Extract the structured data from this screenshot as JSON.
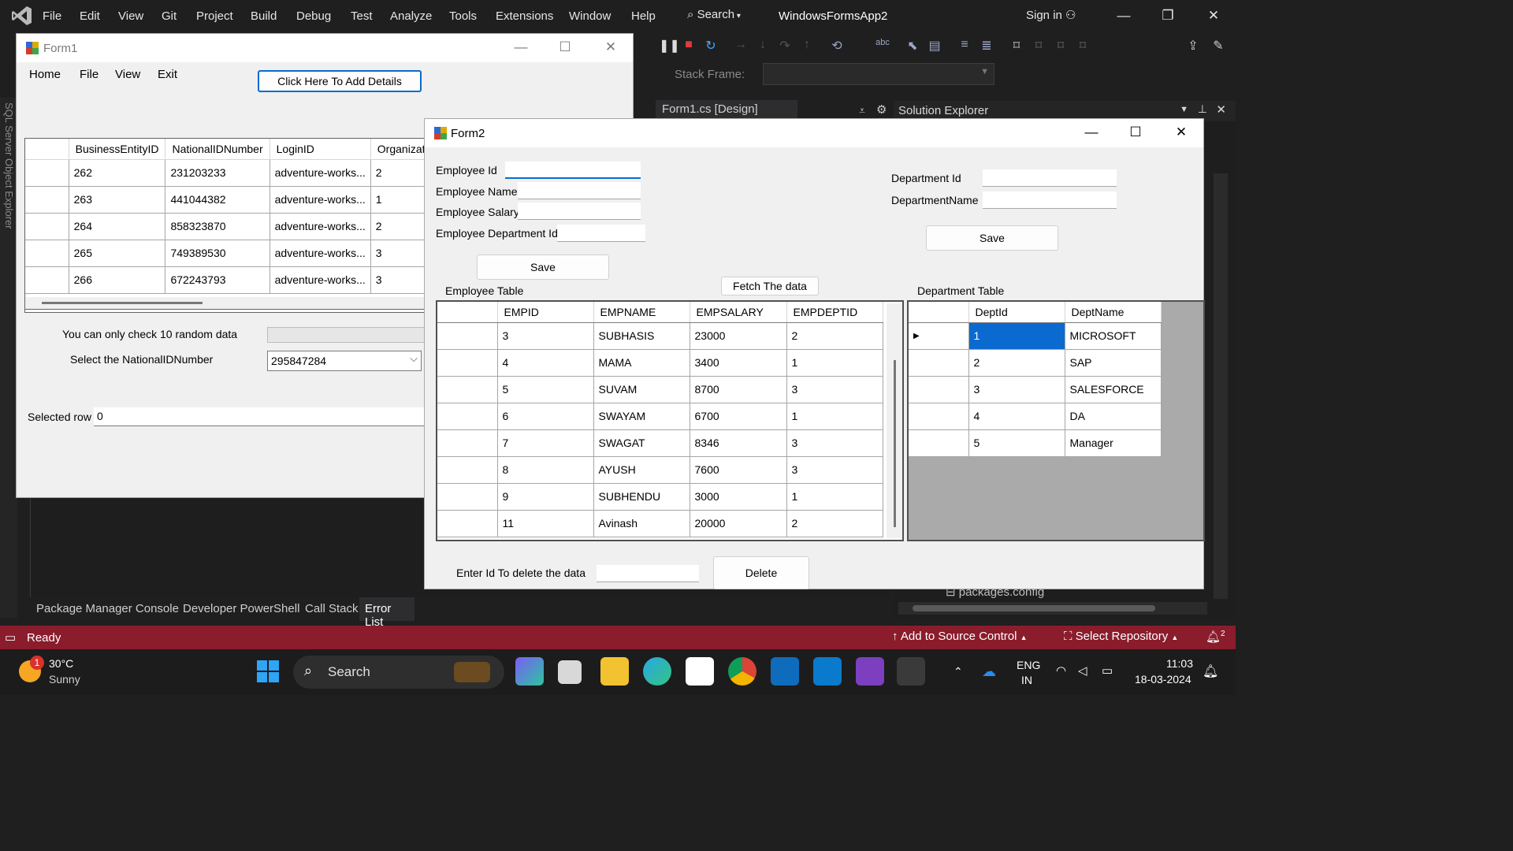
{
  "vs": {
    "menu": [
      "File",
      "Edit",
      "View",
      "Git",
      "Project",
      "Build",
      "Debug",
      "Test",
      "Analyze",
      "Tools",
      "Extensions",
      "Window",
      "Help"
    ],
    "search_label": "Search",
    "app_name": "WindowsFormsApp2",
    "sign_in": "Sign in",
    "stack_frame_label": "Stack Frame:",
    "design_tab": "Form1.cs [Design]",
    "solution_explorer_title": "Solution Explorer",
    "packages_config": "packages.config",
    "left_stripe_text": "SQL Server Object Explorer",
    "bottom_tabs": [
      "Package Manager Console",
      "Developer PowerShell",
      "Call Stack",
      "Error List"
    ]
  },
  "statusbar": {
    "ready": "Ready",
    "add_source": "Add to Source Control",
    "select_repo": "Select Repository",
    "notif_count": "2"
  },
  "taskbar": {
    "weather_badge": "1",
    "temp": "30°C",
    "condition": "Sunny",
    "search": "Search",
    "lang1": "ENG",
    "lang2": "IN",
    "time": "11:03",
    "date": "18-03-2024"
  },
  "form1": {
    "title": "Form1",
    "menu": [
      "Home",
      "File",
      "View",
      "Exit"
    ],
    "add_button": "Click Here To Add Details",
    "grid_headers": [
      "BusinessEntityID",
      "NationalIDNumber",
      "LoginID",
      "Organizat"
    ],
    "grid_rows": [
      [
        "262",
        "231203233",
        "adventure-works...",
        "2"
      ],
      [
        "263",
        "441044382",
        "adventure-works...",
        "1"
      ],
      [
        "264",
        "858323870",
        "adventure-works...",
        "2"
      ],
      [
        "265",
        "749389530",
        "adventure-works...",
        "3"
      ],
      [
        "266",
        "672243793",
        "adventure-works...",
        "3"
      ]
    ],
    "random_label": "You can only check 10 random data",
    "select_label": "Select the NationalIDNumber",
    "select_value": "295847284",
    "selected_row_label": "Selected row",
    "selected_row_value": "0"
  },
  "form2": {
    "title": "Form2",
    "emp_id_label": "Employee Id",
    "emp_name_label": "Employee Name",
    "emp_salary_label": "Employee Salary",
    "emp_dept_label": "Employee Department Id",
    "save_label": "Save",
    "dept_id_label": "Department Id",
    "dept_name_label": "DepartmentName",
    "dept_save_label": "Save",
    "fetch_label": "Fetch The data",
    "emp_table_label": "Employee Table",
    "dept_table_label": "Department Table",
    "emp_headers": [
      "EMPID",
      "EMPNAME",
      "EMPSALARY",
      "EMPDEPTID"
    ],
    "emp_rows": [
      [
        "3",
        "SUBHASIS",
        "23000",
        "2"
      ],
      [
        "4",
        "MAMA",
        "3400",
        "1"
      ],
      [
        "5",
        "SUVAM",
        "8700",
        "3"
      ],
      [
        "6",
        "SWAYAM",
        "6700",
        "1"
      ],
      [
        "7",
        "SWAGAT",
        "8346",
        "3"
      ],
      [
        "8",
        "AYUSH",
        "7600",
        "3"
      ],
      [
        "9",
        "SUBHENDU",
        "3000",
        "1"
      ],
      [
        "11",
        "Avinash",
        "20000",
        "2"
      ]
    ],
    "dept_headers": [
      "DeptId",
      "DeptName"
    ],
    "dept_rows": [
      [
        "1",
        "MICROSOFT"
      ],
      [
        "2",
        "SAP"
      ],
      [
        "3",
        "SALESFORCE"
      ],
      [
        "4",
        "DA"
      ],
      [
        "5",
        "Manager"
      ]
    ],
    "delete_label": "Enter Id To delete the data",
    "delete_button": "Delete"
  }
}
